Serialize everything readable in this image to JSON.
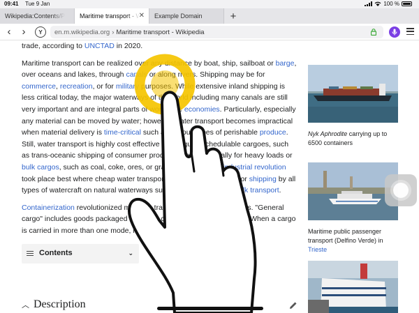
{
  "status_bar": {
    "time": "09:41",
    "date": "Tue 9 Jan",
    "battery": "100 %"
  },
  "tabs": [
    {
      "label": "Wikipedia:Contents/Po",
      "active": false
    },
    {
      "label": "Maritime transport - W",
      "active": true
    },
    {
      "label": "Example Domain",
      "active": false
    }
  ],
  "toolbar": {
    "url_host": "en.m.wikipedia.org",
    "url_sep": "›",
    "url_title": "Maritime transport - Wikipedia"
  },
  "article": {
    "p0": [
      "trade, according to ",
      "UNCTAD",
      " in 2020."
    ],
    "p1": [
      "Maritime transport can be realized over any distance by boat, ship, sailboat or ",
      "barge",
      ", over oceans and lakes, through ",
      "canals",
      " or along rivers. Shipping may be for ",
      "commerce",
      ", ",
      "recreation",
      ", or for ",
      "military",
      " purposes. While extensive inland shipping is less critical today, the major waterways of the world including many canals are still very important and are integral parts of worldwide ",
      "economies",
      ". Particularly, especially any material can be moved by water; however, water transport becomes impractical when material delivery is ",
      "time-critical",
      " such as various types of perishable ",
      "produce",
      ". Still, water transport is highly cost effective with regular schedulable cargoes, such as trans-oceanic shipping of consumer products – and especially for heavy loads or ",
      "bulk cargos",
      ", such as coal, coke, ores, or grains. Arguably, the ",
      "industrial revolution",
      " took place best where cheap water transport by canal, ",
      "navigations",
      ", or ",
      "shipping",
      " by all types of watercraft on natural waterways supported cost-effective ",
      "bulk transport",
      "."
    ],
    "p2": [
      "Containerization",
      " revolutionized maritime transport starting in the 1970s. \"General cargo\" includes goods packaged in boxes, cases, pallets, and barrels. When a cargo is carried in more than one mode, it is ",
      "intermodal",
      " or co-modal."
    ],
    "contents_label": "Contents",
    "section_heading": "Description"
  },
  "thumbnails": [
    {
      "caption_italic": "Nyk Aphrodite",
      "caption_rest": " carrying up to 6500 containers",
      "caption_link": ""
    },
    {
      "caption_italic": "",
      "caption_rest": "Maritime public passenger transport (Delfino Verde) in ",
      "caption_link": "Trieste"
    },
    {
      "caption_italic": "",
      "caption_rest": "",
      "caption_link": ""
    }
  ],
  "colors": {
    "link": "#3366cc",
    "touch_highlight": "#f5c400",
    "accent_mic": "#7b3fe4"
  },
  "icons": [
    "back-icon",
    "forward-icon",
    "y-icon",
    "lock-icon",
    "mic-icon",
    "menu-icon",
    "list-icon",
    "chevron-down-icon",
    "edit-icon",
    "plus-icon",
    "close-icon",
    "wifi-icon",
    "battery-icon"
  ]
}
